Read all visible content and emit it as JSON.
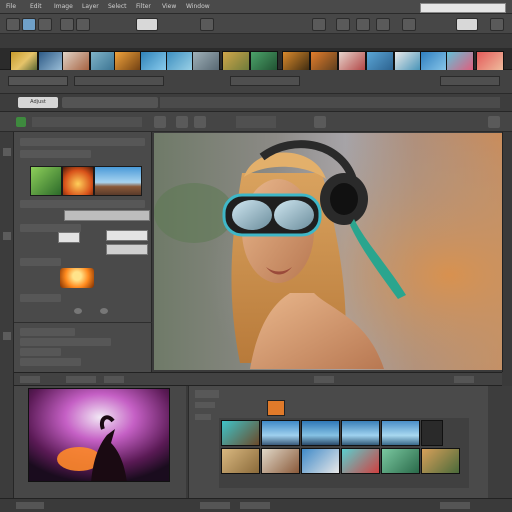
{
  "menubar": {
    "items": [
      "File",
      "Edit",
      "Image",
      "Layer",
      "Select",
      "Filter",
      "View",
      "Window"
    ],
    "search_placeholder": ""
  },
  "tabs": {
    "active_label": "Adjust"
  },
  "viewer": {
    "subject": "woman-with-goggles-and-headphones"
  },
  "colors": {
    "ui_dark": "#3a3a3a",
    "ui_mid": "#4a4a4a",
    "accent_teal": "#3fb7c7",
    "accent_orange": "#ff8a1e"
  },
  "icons": {
    "toolbar": [
      "folder-icon",
      "copy-icon",
      "crop-icon",
      "settings-icon",
      "camera-icon",
      "grid-icon"
    ]
  }
}
